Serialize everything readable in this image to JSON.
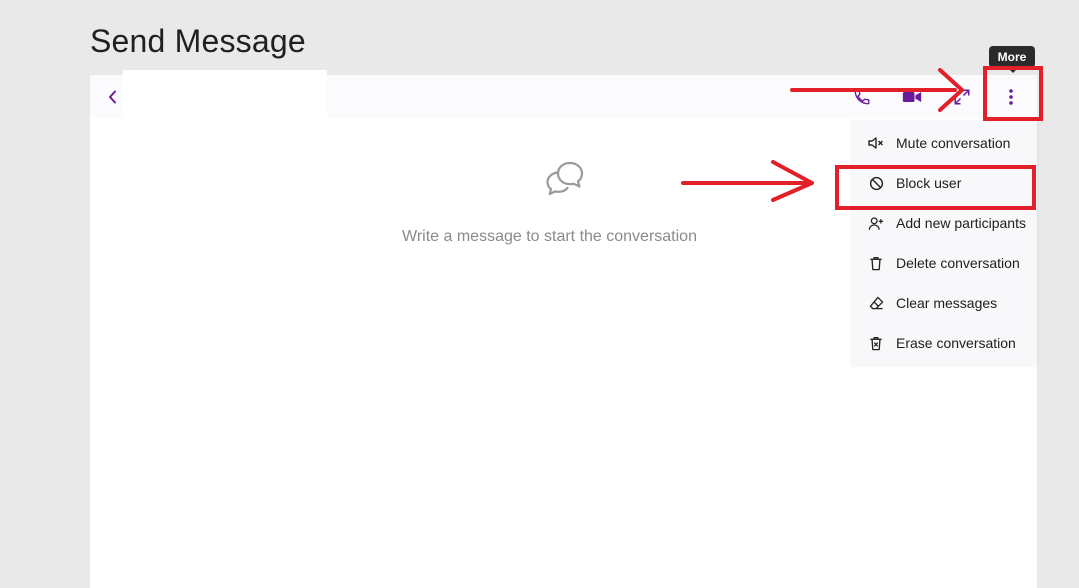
{
  "page": {
    "title": "Send Message"
  },
  "header": {
    "icons": [
      "chevron-left-icon",
      "phone-icon",
      "video-camera-icon",
      "expand-icon",
      "more-vertical-icon"
    ],
    "accent_color": "#6a1b9a"
  },
  "tooltip": {
    "text": "More"
  },
  "empty_state": {
    "icon": "chat-bubbles-icon",
    "text": "Write a message to start the conversation"
  },
  "menu": {
    "items": [
      {
        "label": "Mute conversation",
        "icon": "mute-icon"
      },
      {
        "label": "Block user",
        "icon": "block-icon"
      },
      {
        "label": "Add new participants",
        "icon": "add-user-icon"
      },
      {
        "label": "Delete conversation",
        "icon": "trash-icon"
      },
      {
        "label": "Clear messages",
        "icon": "eraser-icon"
      },
      {
        "label": "Erase conversation",
        "icon": "trash-x-icon"
      }
    ]
  },
  "annotations": {
    "color": "#e3202a"
  }
}
